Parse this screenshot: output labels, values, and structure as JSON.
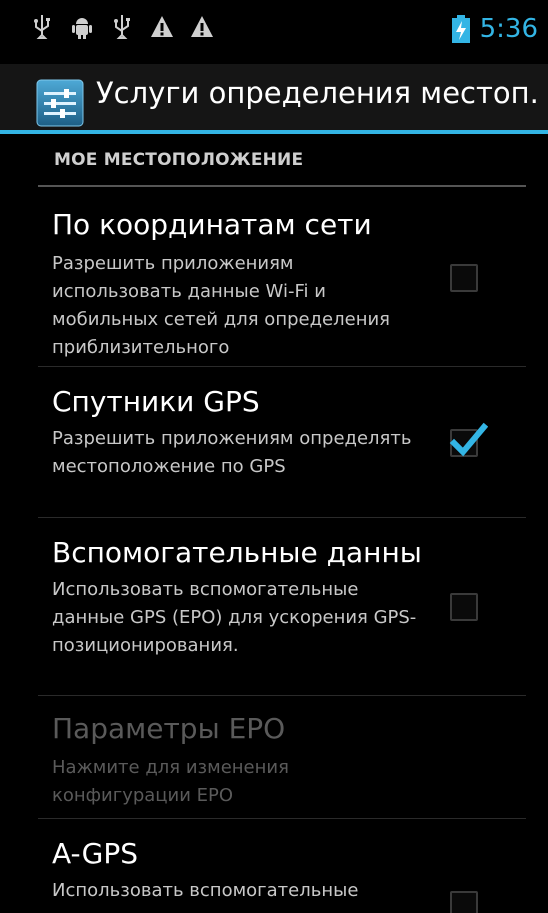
{
  "status": {
    "time": "5:36",
    "icons": [
      "usb-icon",
      "android-debug-icon",
      "usb-icon",
      "warning-icon",
      "warning-icon"
    ]
  },
  "actionbar": {
    "title": "Услуги определения местоп..."
  },
  "section": {
    "header": "МОЕ МЕСТОПОЛОЖЕНИЕ"
  },
  "prefs": [
    {
      "title": "По координатам сети",
      "summary": "Разрешить приложениям использовать данные Wi-Fi и мобильных сетей для определения приблизительного",
      "checked": false
    },
    {
      "title": "Спутники GPS",
      "summary": "Разрешить приложениям определять местоположение по GPS",
      "checked": true
    },
    {
      "title": "Вспомогательные данны",
      "summary": "Использовать вспомогательные данные GPS (EPO) для ускорения GPS-позиционирования.",
      "checked": false
    },
    {
      "title": "Параметры EPO",
      "summary": "Нажмите для изменения конфигурации EPO",
      "enabled": false
    },
    {
      "title": "A-GPS",
      "summary": "Использовать вспомогательные данные для",
      "checked": false
    }
  ],
  "colors": {
    "accent": "#33b5e5",
    "background": "#000000"
  }
}
